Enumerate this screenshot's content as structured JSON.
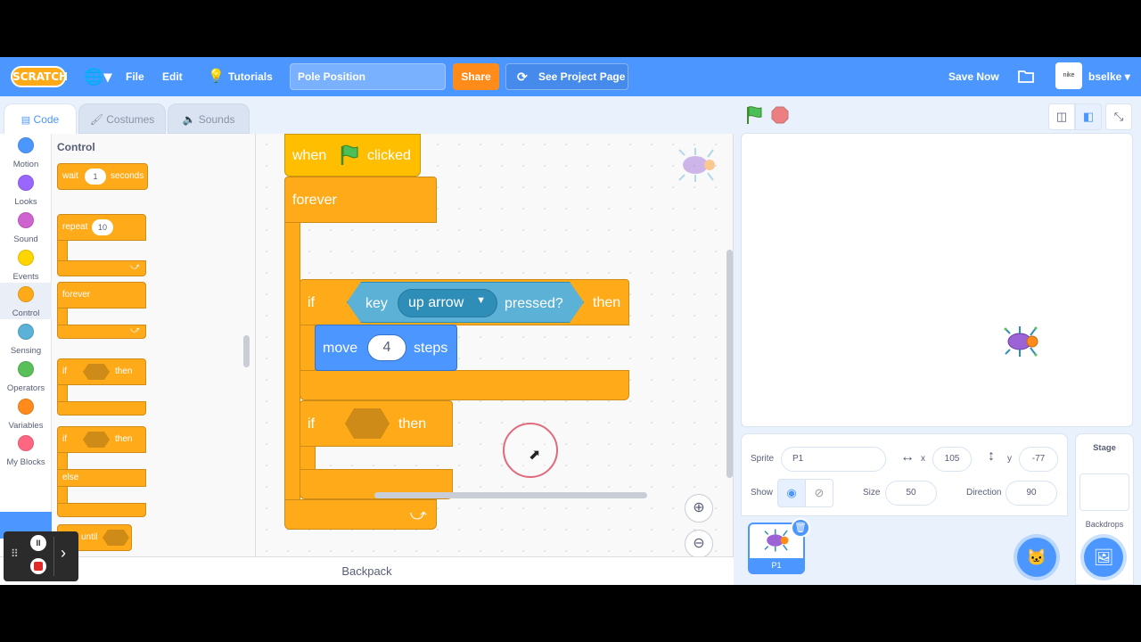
{
  "menubar": {
    "logo": "SCRATCH",
    "file": "File",
    "edit": "Edit",
    "tutorials": "Tutorials",
    "project_title": "Pole Position",
    "share": "Share",
    "see_project_page": "See Project Page",
    "save_now": "Save Now",
    "username": "bselke"
  },
  "tabs": {
    "code": "Code",
    "costumes": "Costumes",
    "sounds": "Sounds"
  },
  "categories": [
    {
      "label": "Motion",
      "color": "#4c97ff"
    },
    {
      "label": "Looks",
      "color": "#9966ff"
    },
    {
      "label": "Sound",
      "color": "#cf63cf"
    },
    {
      "label": "Events",
      "color": "#ffd500"
    },
    {
      "label": "Control",
      "color": "#ffab19"
    },
    {
      "label": "Sensing",
      "color": "#5cb1d6"
    },
    {
      "label": "Operators",
      "color": "#59c059"
    },
    {
      "label": "Variables",
      "color": "#ff8c1a"
    },
    {
      "label": "My Blocks",
      "color": "#ff6680"
    }
  ],
  "palette": {
    "title": "Control",
    "wait": "wait",
    "wait_value": "1",
    "seconds": "seconds",
    "repeat": "repeat",
    "repeat_value": "10",
    "forever": "forever",
    "if": "if",
    "then": "then",
    "if2": "if",
    "then2": "then",
    "else": "else",
    "until": "until"
  },
  "script": {
    "when": "when",
    "clicked": "clicked",
    "forever": "forever",
    "if1": "if",
    "key": "key",
    "key_option": "up arrow",
    "pressed": "pressed?",
    "then1": "then",
    "move": "move",
    "move_value": "4",
    "steps": "steps",
    "if2": "if",
    "then2": "then"
  },
  "backpack": "Backpack",
  "sprite_info": {
    "sprite_label": "Sprite",
    "sprite_name": "P1",
    "x_label": "x",
    "x_value": "105",
    "y_label": "y",
    "y_value": "-77",
    "show_label": "Show",
    "size_label": "Size",
    "size_value": "50",
    "direction_label": "Direction",
    "direction_value": "90"
  },
  "sprite_list": [
    {
      "name": "P1"
    }
  ],
  "stage_pane": {
    "title": "Stage",
    "backdrops": "Backdrops"
  }
}
